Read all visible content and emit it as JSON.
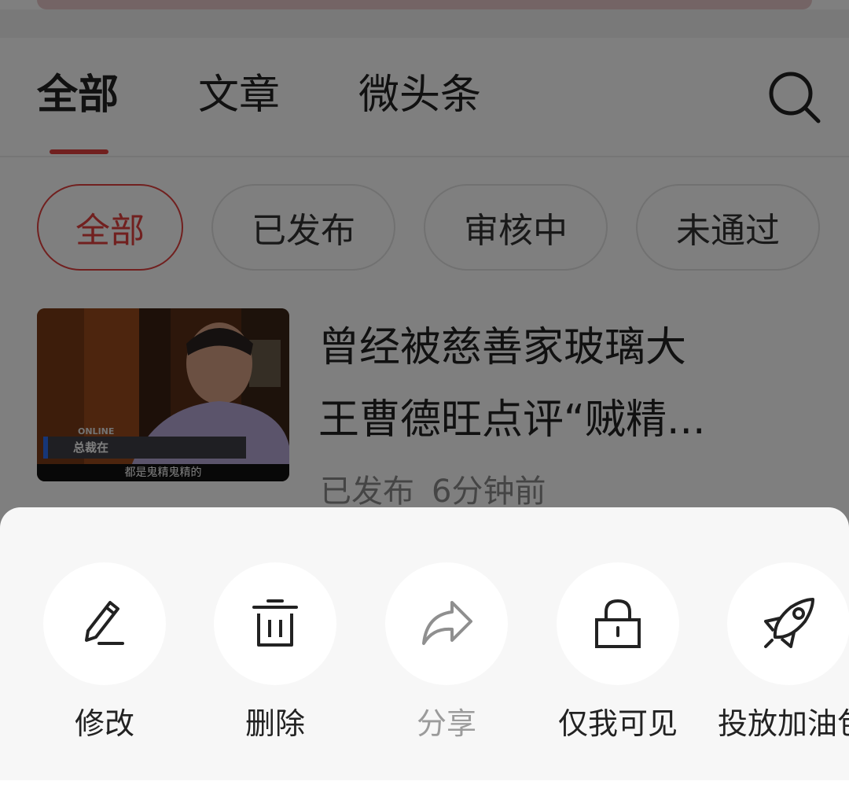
{
  "tabs": {
    "all": "全部",
    "articles": "文章",
    "micro": "微头条"
  },
  "filters": {
    "all": "全部",
    "published": "已发布",
    "reviewing": "审核中",
    "rejected": "未通过"
  },
  "article": {
    "title_line1": "曾经被慈善家玻璃大",
    "title_line2": "王曹德旺点评“贼精...",
    "status": "已发布",
    "time": "6分钟前",
    "thumb_caption": "都是鬼精鬼精的",
    "thumb_tag1": "总裁在",
    "thumb_tag2": "ONLINE"
  },
  "actions": {
    "edit": "修改",
    "delete": "删除",
    "share": "分享",
    "private": "仅我可见",
    "boost": "投放加油包"
  },
  "colors": {
    "accent": "#e2403f"
  },
  "icons": [
    "search-icon",
    "pencil-icon",
    "trash-icon",
    "share-icon",
    "lock-icon",
    "rocket-icon"
  ]
}
